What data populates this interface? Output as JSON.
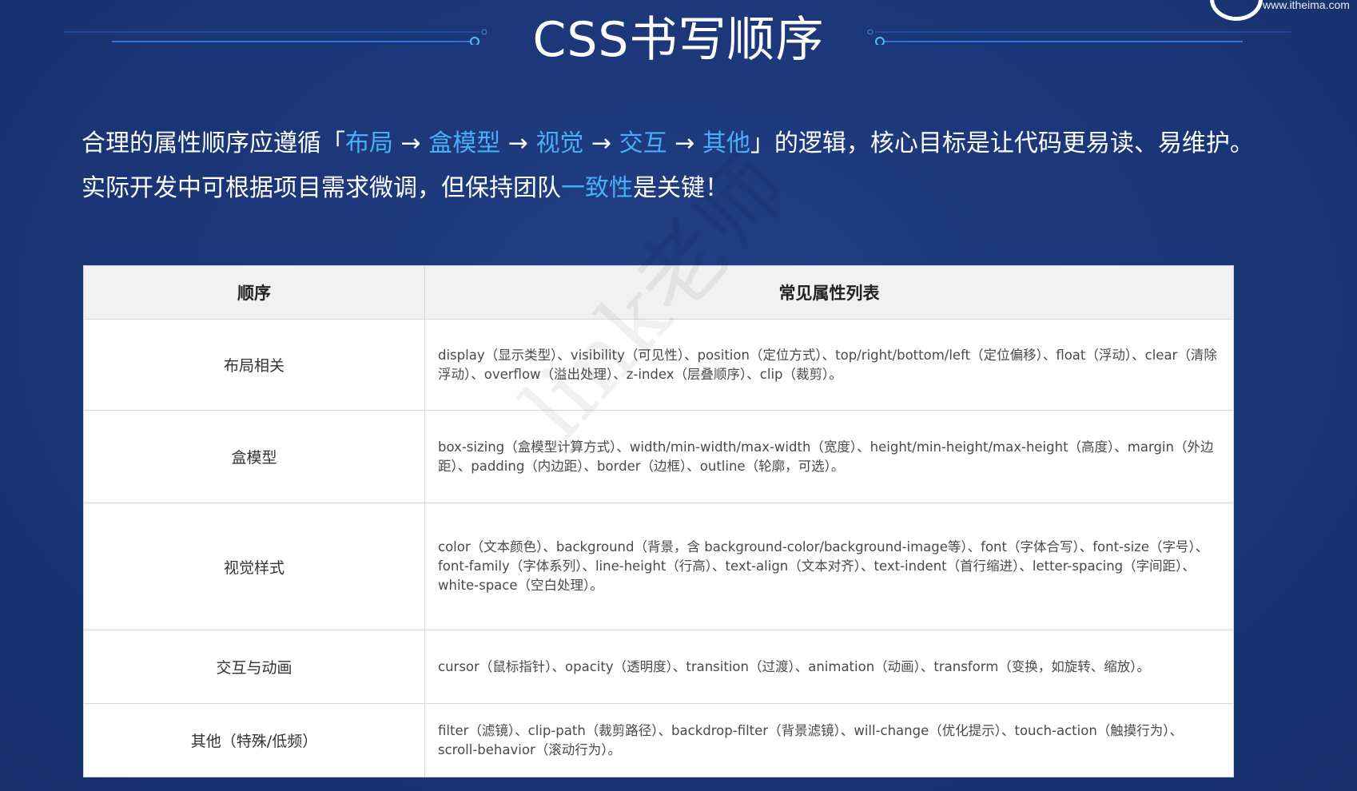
{
  "header": {
    "title": "CSS书写顺序",
    "logo_text": "www.itheima.com"
  },
  "intro": {
    "line1_parts": [
      {
        "text": "合理的属性顺序应遵循「",
        "hl": false
      },
      {
        "text": "布局",
        "hl": true
      },
      {
        "text": " → ",
        "hl": false
      },
      {
        "text": "盒模型",
        "hl": true
      },
      {
        "text": " → ",
        "hl": false
      },
      {
        "text": "视觉",
        "hl": true
      },
      {
        "text": " → ",
        "hl": false
      },
      {
        "text": "交互",
        "hl": true
      },
      {
        "text": " → ",
        "hl": false
      },
      {
        "text": "其他",
        "hl": true
      },
      {
        "text": "」的逻辑，核心目标是让代码更易读、易维护。",
        "hl": false
      }
    ],
    "line2_parts": [
      {
        "text": "实际开发中可根据项目需求微调，但保持团队",
        "hl": false
      },
      {
        "text": "一致性",
        "hl": true
      },
      {
        "text": "是关键！",
        "hl": false
      }
    ],
    "highlight_color": "#48aef7"
  },
  "table": {
    "headers": [
      "顺序",
      "常见属性列表"
    ],
    "rows": [
      {
        "order": "布局相关",
        "props": "display（显示类型）、visibility（可见性）、position（定位方式）、top/right/bottom/left（定位偏移）、float（浮动）、clear（清除浮动）、overflow（溢出处理）、z-index（层叠顺序）、clip（裁剪）。"
      },
      {
        "order": "盒模型",
        "props": "box-sizing（盒模型计算方式）、width/min-width/max-width（宽度）、height/min-height/max-height（高度）、margin（外边距）、padding（内边距）、border（边框）、outline（轮廓，可选）。"
      },
      {
        "order": "视觉样式",
        "props": "color（文本颜色）、background（背景，含 background-color/background-image等）、font（字体合写）、font-size（字号）、font-family（字体系列）、line-height（行高）、text-align（文本对齐）、text-indent（首行缩进）、letter-spacing（字间距）、white-space（空白处理）。"
      },
      {
        "order": "交互与动画",
        "props": "cursor（鼠标指针）、opacity（透明度）、transition（过渡）、animation（动画）、transform（变换，如旋转、缩放）。"
      },
      {
        "order": "其他（特殊/低频）",
        "props": "filter（滤镜）、clip-path（裁剪路径）、backdrop-filter（背景滤镜）、will-change（优化提示）、touch-action（触摸行为）、scroll-behavior（滚动行为）。"
      }
    ]
  },
  "watermark": "link老师",
  "colors": {
    "background": "#1b3677",
    "accent": "#48aef7",
    "header_row": "#f1f1f1"
  }
}
